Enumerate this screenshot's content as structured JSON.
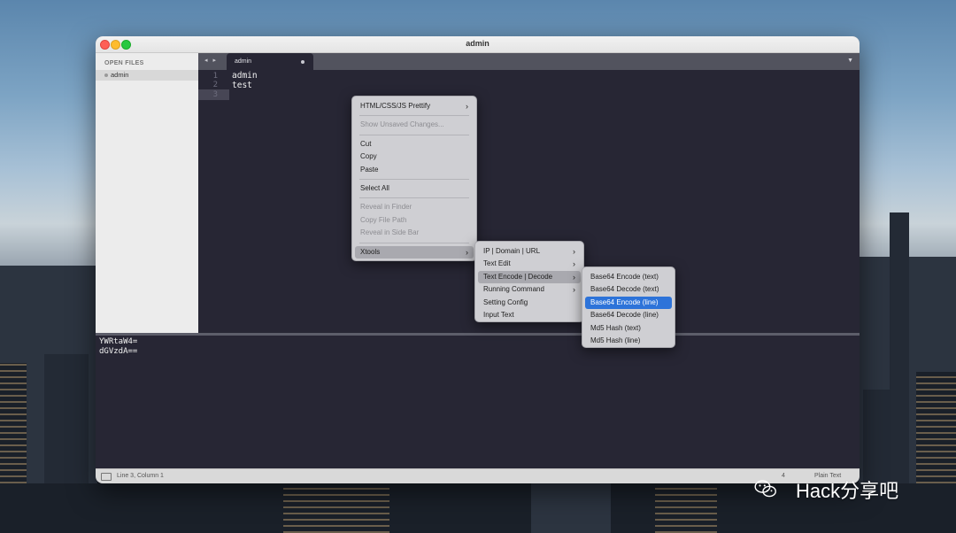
{
  "window": {
    "title": "admin"
  },
  "sidebar": {
    "header": "OPEN FILES",
    "files": [
      {
        "name": "admin"
      }
    ]
  },
  "tabbar": {
    "nav": "◂ ▸",
    "tab_label": "admin",
    "dropdown": "▼"
  },
  "editor": {
    "lines": [
      {
        "num": "1",
        "text": "admin"
      },
      {
        "num": "2",
        "text": "test"
      },
      {
        "num": "3",
        "text": ""
      }
    ]
  },
  "output_panel": {
    "lines": [
      "YWRtaW4=",
      "dGVzdA=="
    ]
  },
  "status": {
    "position": "Line 3, Column 1",
    "tab_size": "4",
    "syntax": "Plain Text"
  },
  "context_menu": {
    "items": [
      {
        "label": "HTML/CSS/JS Prettify",
        "submenu": true
      },
      {
        "label": "Show Unsaved Changes...",
        "disabled": true
      },
      {
        "label": "Cut"
      },
      {
        "label": "Copy"
      },
      {
        "label": "Paste"
      },
      {
        "label": "Select All"
      },
      {
        "label": "Reveal in Finder",
        "disabled": true
      },
      {
        "label": "Copy File Path",
        "disabled": true
      },
      {
        "label": "Reveal in Side Bar",
        "disabled": true
      },
      {
        "label": "Xtools",
        "submenu": true,
        "highlighted": true
      }
    ]
  },
  "xtools_menu": {
    "items": [
      {
        "label": "IP | Domain | URL",
        "submenu": true
      },
      {
        "label": "Text Edit",
        "submenu": true
      },
      {
        "label": "Text Encode | Decode",
        "submenu": true,
        "highlighted": true
      },
      {
        "label": "Running Command",
        "submenu": true
      },
      {
        "label": "Setting Config"
      },
      {
        "label": "Input Text"
      }
    ]
  },
  "encode_menu": {
    "items": [
      {
        "label": "Base64 Encode (text)"
      },
      {
        "label": "Base64 Decode (text)"
      },
      {
        "label": "Base64 Encode (line)",
        "selected": true
      },
      {
        "label": "Base64 Decode (line)"
      },
      {
        "label": "Md5 Hash (text)"
      },
      {
        "label": "Md5 Hash (line)"
      }
    ]
  },
  "watermark": {
    "text": "Hack分享吧"
  },
  "colors": {
    "editor_bg": "#272634",
    "selection": "#2d73d9",
    "menu_bg": "#cfcfd3"
  },
  "icons": {
    "chevron": "›"
  }
}
